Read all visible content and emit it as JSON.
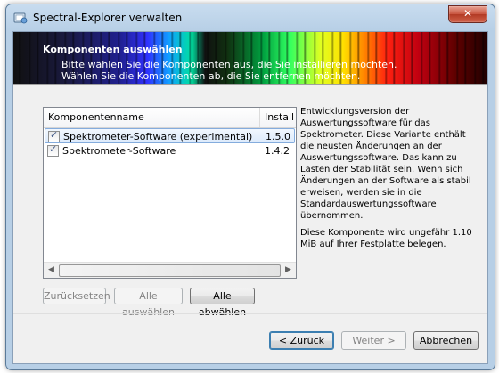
{
  "window": {
    "title": "Spectral-Explorer verwalten",
    "close_label": "✕"
  },
  "banner": {
    "title": "Komponenten auswählen",
    "subtitle": "Bitte wählen Sie die Komponenten aus, die Sie installieren möchten. Wählen Sie die Komponenten ab, die Sie entfernen möchten."
  },
  "list": {
    "columns": [
      "Komponentenname",
      "Install"
    ],
    "rows": [
      {
        "name": "Spektrometer-Software (experimental)",
        "version": "1.5.0",
        "checked": true,
        "selected": true
      },
      {
        "name": "Spektrometer-Software",
        "version": "1.4.2",
        "checked": true,
        "selected": false
      }
    ]
  },
  "description": {
    "text": "Entwicklungsversion der Auswertungssoftware für das Spektrometer. Diese Variante enthält die neusten Änderungen an der Auswertungssoftware. Das kann zu Lasten der Stabilität sein. Wenn sich Änderungen an der Software als stabil erweisen, werden sie in die Standardauswertungssoftware übernommen.",
    "size_note": "Diese Komponente wird ungefähr 1.10 MiB auf Ihrer Festplatte belegen."
  },
  "selection_buttons": {
    "reset": "Zurücksetzen",
    "select_all": "Alle auswählen",
    "deselect_all": "Alle abwählen"
  },
  "nav_buttons": {
    "back": "< Zurück",
    "next": "Weiter >",
    "cancel": "Abbrechen"
  },
  "icons": {
    "window": "installer-icon",
    "check": "✓"
  }
}
